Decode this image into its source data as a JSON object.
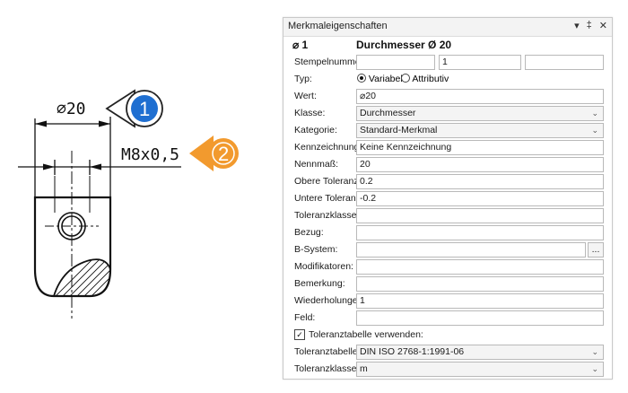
{
  "drawing": {
    "dim1_text": "⌀20",
    "dim2_text": "M8x0,5",
    "bubble1": "1",
    "bubble2": "2",
    "bubble1_color": "#1f6fd1",
    "bubble2_color": "#f29a2e"
  },
  "panel": {
    "title": "Merkmaleigenschaften",
    "icons": {
      "dropdown": "▾",
      "pin": "‡",
      "close": "✕"
    },
    "header": {
      "symbol": "⌀ 1",
      "title": "Durchmesser Ø 20"
    },
    "rows": {
      "stempel": {
        "label": "Stempelnummer:",
        "value1": "",
        "value2": "1",
        "value3": ""
      },
      "typ": {
        "label": "Typ:",
        "option1": "Variabel",
        "option2": "Attributiv"
      },
      "wert": {
        "label": "Wert:",
        "value": "⌀20"
      },
      "klasse": {
        "label": "Klasse:",
        "value": "Durchmesser"
      },
      "kategorie": {
        "label": "Kategorie:",
        "value": "Standard-Merkmal"
      },
      "kennzeichnung": {
        "label": "Kennzeichnung:",
        "value": "Keine Kennzeichnung"
      },
      "nennmass": {
        "label": "Nennmaß:",
        "value": "20"
      },
      "obere": {
        "label": "Obere Toleranz:",
        "value": "0.2"
      },
      "untere": {
        "label": "Untere Toleranz:",
        "value": "-0.2"
      },
      "tolklasse": {
        "label": "Toleranzklasse:",
        "value": ""
      },
      "bezug": {
        "label": "Bezug:",
        "value": ""
      },
      "bsystem": {
        "label": "B-System:",
        "value": "",
        "button": "..."
      },
      "modifikatoren": {
        "label": "Modifikatoren:",
        "value": ""
      },
      "bemerkung": {
        "label": "Bemerkung:",
        "value": ""
      },
      "wiederholungen": {
        "label": "Wiederholungen:",
        "value": "1"
      },
      "feld": {
        "label": "Feld:",
        "value": ""
      },
      "toltab_check": {
        "label": "Toleranztabelle verwenden:",
        "checked": "✓"
      },
      "toltab": {
        "label": "Toleranztabelle:",
        "value": "DIN ISO 2768-1:1991-06"
      },
      "tolklasse2": {
        "label": "Toleranzklasse:",
        "value": "m"
      }
    }
  }
}
